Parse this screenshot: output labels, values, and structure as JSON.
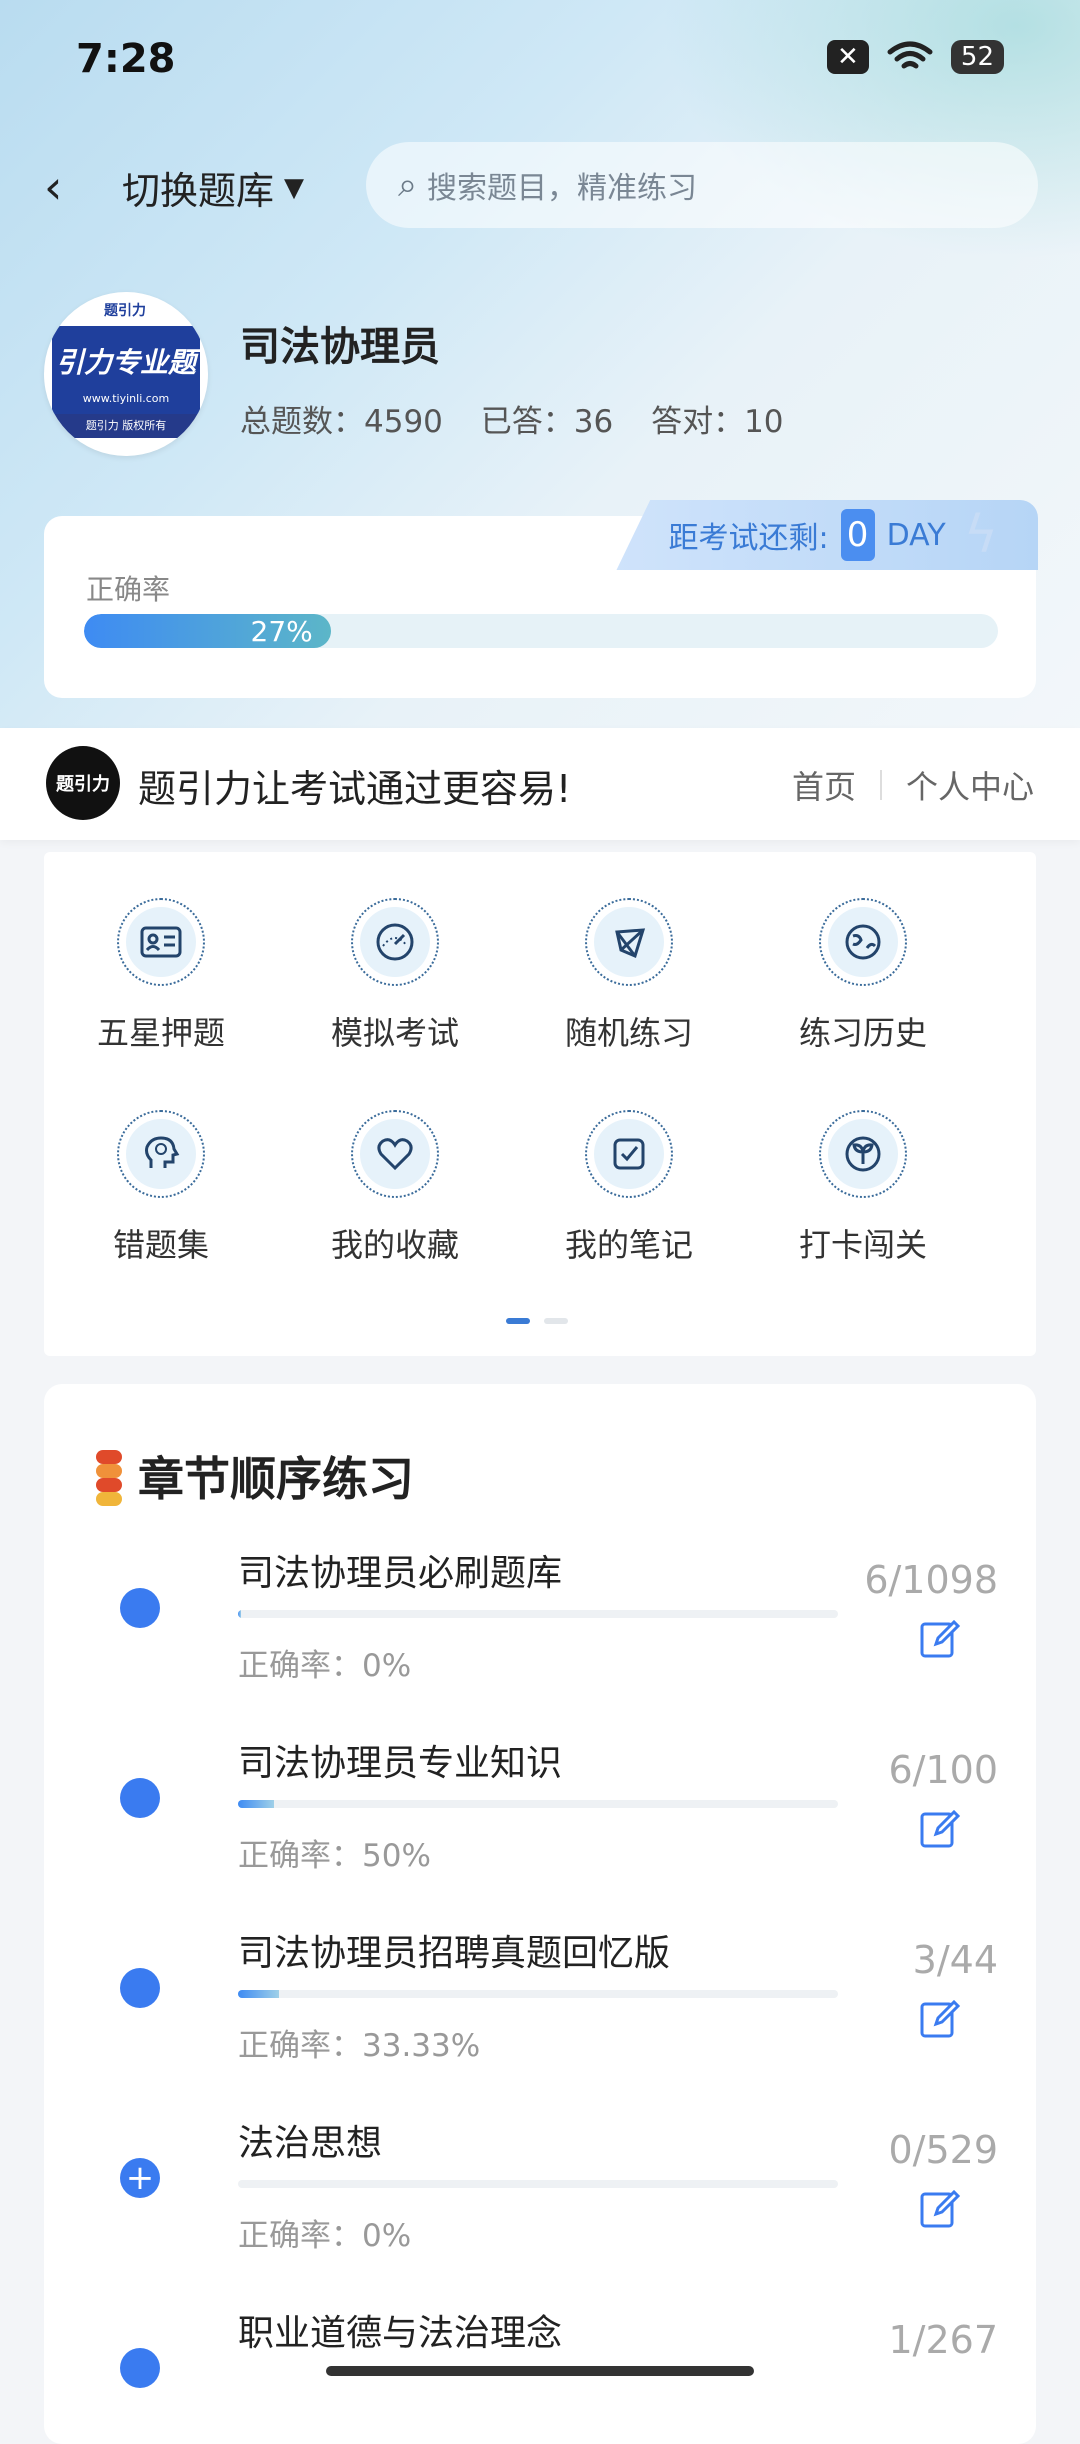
{
  "status": {
    "time": "7:28",
    "battery": "52"
  },
  "header": {
    "back_icon": "back-arrow-icon",
    "switch_label": "切换题库",
    "search_placeholder": "搜索题目，精准练习"
  },
  "bank": {
    "title": "司法协理员",
    "logo": {
      "top": "题引力",
      "main": "引力专业题",
      "url": "www.tiyinli.com",
      "foot": "题引力 版权所有"
    },
    "total_label": "总题数：4590",
    "answered_label": "已答：36",
    "correct_label": "答对：10"
  },
  "accuracy": {
    "label": "正确率",
    "percent_text": "27%",
    "percent": 27
  },
  "countdown": {
    "label": "距考试还剩:",
    "value": "0",
    "unit": "DAY"
  },
  "brand": {
    "logo_text": "题引力",
    "slogan": "题引力让考试通过更容易!",
    "nav_home": "首页",
    "nav_me": "个人中心"
  },
  "features": [
    {
      "label": "五星押题",
      "icon": "id-card-icon"
    },
    {
      "label": "模拟考试",
      "icon": "gauge-icon"
    },
    {
      "label": "随机练习",
      "icon": "network-icon"
    },
    {
      "label": "练习历史",
      "icon": "globe-icon"
    },
    {
      "label": "错题集",
      "icon": "brain-head-icon"
    },
    {
      "label": "我的收藏",
      "icon": "heart-icon"
    },
    {
      "label": "我的笔记",
      "icon": "note-check-icon"
    },
    {
      "label": "打卡闯关",
      "icon": "sprout-icon"
    }
  ],
  "chapters": {
    "title": "章节顺序练习",
    "items": [
      {
        "name": "司法协理员必刷题库",
        "rate": "正确率：0%",
        "count": "6/1098",
        "progress": 0.005
      },
      {
        "name": "司法协理员专业知识",
        "rate": "正确率：50%",
        "count": "6/100",
        "progress": 0.06
      },
      {
        "name": "司法协理员招聘真题回忆版",
        "rate": "正确率：33.33%",
        "count": "3/44",
        "progress": 0.068
      },
      {
        "name": "法治思想",
        "rate": "正确率：0%",
        "count": "0/529",
        "progress": 0,
        "expandable": true
      },
      {
        "name": "职业道德与法治理念",
        "rate": "",
        "count": "1/267",
        "progress": 0.004
      }
    ]
  }
}
